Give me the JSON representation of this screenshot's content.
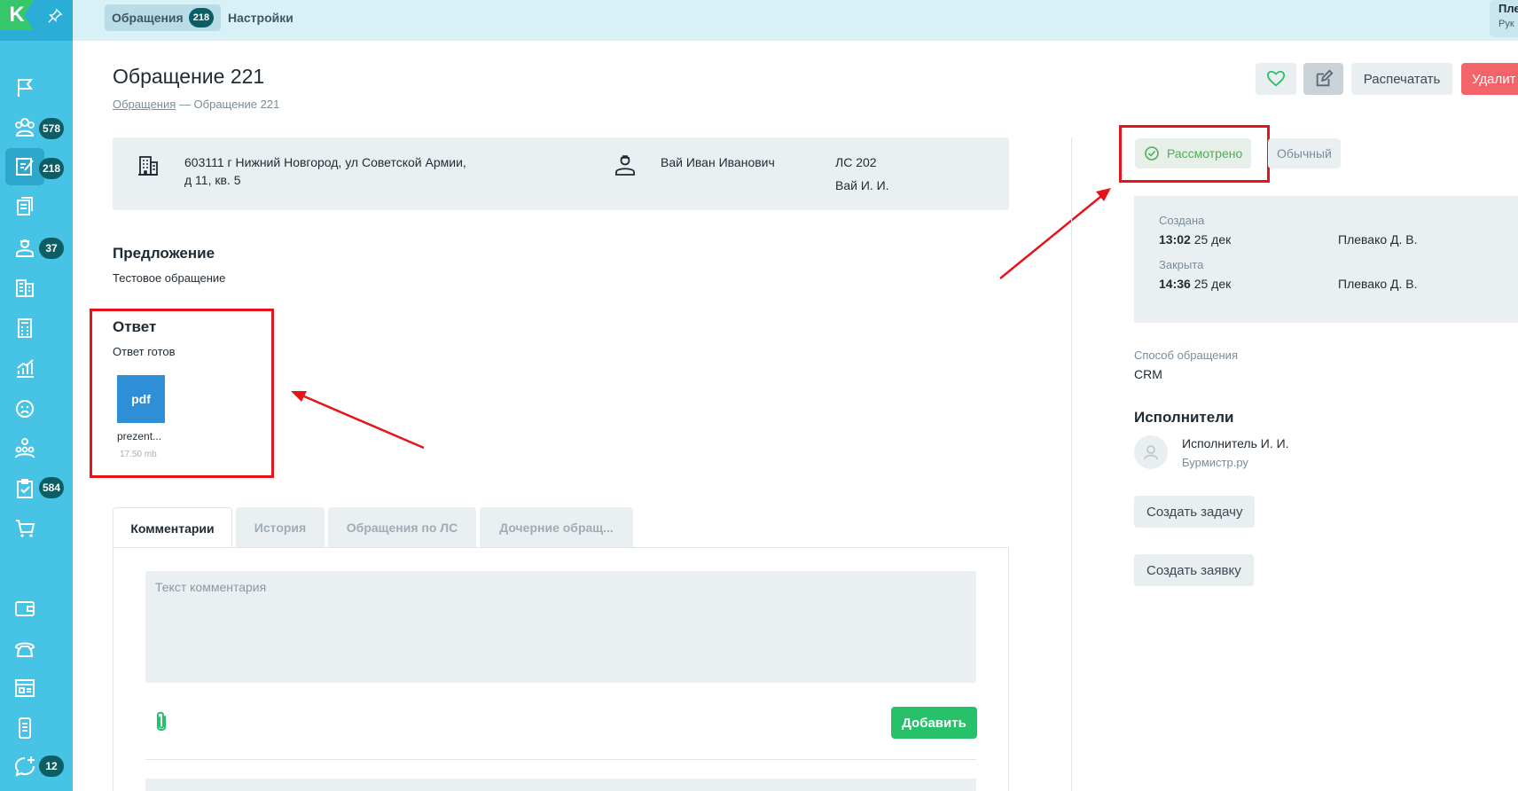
{
  "app": {
    "logo_letter": "K"
  },
  "sidebar": {
    "items": [
      {
        "icon": "flag-icon",
        "badge": ""
      },
      {
        "icon": "people-icon",
        "badge": "578"
      },
      {
        "icon": "edit-document-icon",
        "badge": "218"
      },
      {
        "icon": "documents-icon",
        "badge": ""
      },
      {
        "icon": "worker-icon",
        "badge": "37"
      },
      {
        "icon": "building-icon",
        "badge": ""
      },
      {
        "icon": "calculator-icon",
        "badge": ""
      },
      {
        "icon": "chart-icon",
        "badge": ""
      },
      {
        "icon": "sad-face-icon",
        "badge": ""
      },
      {
        "icon": "org-chart-icon",
        "badge": ""
      },
      {
        "icon": "checklist-icon",
        "badge": "584"
      },
      {
        "icon": "cart-icon",
        "badge": ""
      },
      {
        "icon": "wallet-icon",
        "badge": ""
      },
      {
        "icon": "phone-icon",
        "badge": ""
      },
      {
        "icon": "browser-icon",
        "badge": ""
      },
      {
        "icon": "mobile-icon",
        "badge": ""
      },
      {
        "icon": "chat-add-icon",
        "badge": "12"
      }
    ]
  },
  "topbar": {
    "tabs": [
      {
        "label": "Обращения",
        "badge": "218"
      },
      {
        "label": "Настройки"
      }
    ],
    "user_name": "Пле",
    "user_role": "Рук"
  },
  "header": {
    "title": "Обращение 221",
    "breadcrumb_link": "Обращения",
    "breadcrumb_sep": "—",
    "breadcrumb_current": "Обращение 221",
    "print_label": "Распечатать",
    "delete_label": "Удалит"
  },
  "info": {
    "address_line1": "603111 г Нижний Новгород, ул Советской Армии,",
    "address_line2": "д 11, кв. 5",
    "person": "Вай Иван Иванович",
    "account": "ЛС 202",
    "account_owner": "Вай И. И."
  },
  "proposal": {
    "title": "Предложение",
    "text": "Тестовое обращение"
  },
  "answer": {
    "title": "Ответ",
    "text": "Ответ готов",
    "file_type": "pdf",
    "file_name": "prezent...",
    "file_size": "17.50 mb"
  },
  "tabs": [
    {
      "label": "Комментарии",
      "active": true
    },
    {
      "label": "История",
      "active": false
    },
    {
      "label": "Обращения по ЛС",
      "active": false
    },
    {
      "label": "Дочерние обращ...",
      "active": false
    }
  ],
  "comment": {
    "placeholder": "Текст комментария",
    "add_label": "Добавить"
  },
  "status": {
    "reviewed": "Рассмотрено",
    "priority": "Обычный"
  },
  "dates": {
    "created_label": "Создана",
    "created_time": "13:02",
    "created_date": "25 дек",
    "created_by": "Плевако Д. В.",
    "closed_label": "Закрыта",
    "closed_time": "14:36",
    "closed_date": "25 дек",
    "closed_by": "Плевако Д. В."
  },
  "channel": {
    "label": "Способ обращения",
    "value": "CRM"
  },
  "executors": {
    "title": "Исполнители",
    "name": "Исполнитель И. И.",
    "company": "Бурмистр.ру"
  },
  "actions": {
    "create_task": "Создать задачу",
    "create_request": "Создать заявку"
  },
  "colors": {
    "sidebar": "#47c3e6",
    "accent_green": "#27c16a",
    "highlight_red": "#e3151b",
    "badge": "#0d5e64"
  }
}
